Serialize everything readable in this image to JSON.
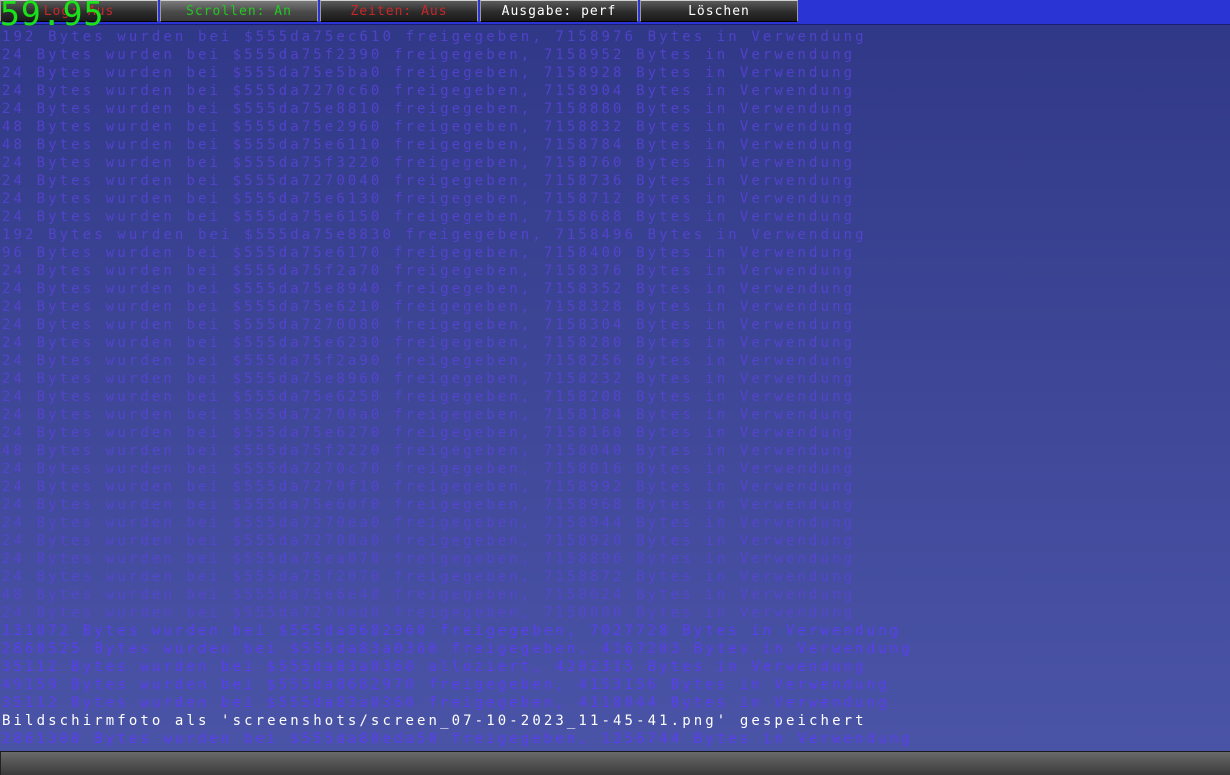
{
  "fps": "59.95",
  "toolbar": {
    "buttons": [
      {
        "label": "Log: Aus"
      },
      {
        "label": "Scrollen: An"
      },
      {
        "label": "Zeiten: Aus"
      },
      {
        "label": "Ausgabe: perf"
      },
      {
        "label": "Löschen"
      }
    ]
  },
  "console": {
    "lines": [
      "192 Bytes wurden bei $555da75ec610 freigegeben, 7158976 Bytes in Verwendung",
      "24 Bytes wurden bei $555da75f2390 freigegeben, 7158952 Bytes in Verwendung",
      "24 Bytes wurden bei $555da75e5ba0 freigegeben, 7158928 Bytes in Verwendung",
      "24 Bytes wurden bei $555da7270c60 freigegeben, 7158904 Bytes in Verwendung",
      "24 Bytes wurden bei $555da75e8810 freigegeben, 7158880 Bytes in Verwendung",
      "48 Bytes wurden bei $555da75e2960 freigegeben, 7158832 Bytes in Verwendung",
      "48 Bytes wurden bei $555da75e6110 freigegeben, 7158784 Bytes in Verwendung",
      "24 Bytes wurden bei $555da75f3220 freigegeben, 7158760 Bytes in Verwendung",
      "24 Bytes wurden bei $555da7270040 freigegeben, 7158736 Bytes in Verwendung",
      "24 Bytes wurden bei $555da75e6130 freigegeben, 7158712 Bytes in Verwendung",
      "24 Bytes wurden bei $555da75e6150 freigegeben, 7158688 Bytes in Verwendung",
      "192 Bytes wurden bei $555da75e8830 freigegeben, 7158496 Bytes in Verwendung",
      "96 Bytes wurden bei $555da75e6170 freigegeben, 7158400 Bytes in Verwendung",
      "24 Bytes wurden bei $555da75f2a70 freigegeben, 7158376 Bytes in Verwendung",
      "24 Bytes wurden bei $555da75e8940 freigegeben, 7158352 Bytes in Verwendung",
      "24 Bytes wurden bei $555da75e6210 freigegeben, 7158328 Bytes in Verwendung",
      "24 Bytes wurden bei $555da7270080 freigegeben, 7158304 Bytes in Verwendung",
      "24 Bytes wurden bei $555da75e6230 freigegeben, 7158280 Bytes in Verwendung",
      "24 Bytes wurden bei $555da75f2a90 freigegeben, 7158256 Bytes in Verwendung",
      "24 Bytes wurden bei $555da75e8960 freigegeben, 7158232 Bytes in Verwendung",
      "24 Bytes wurden bei $555da75e6250 freigegeben, 7158208 Bytes in Verwendung",
      "24 Bytes wurden bei $555da72700a0 freigegeben, 7158184 Bytes in Verwendung",
      "24 Bytes wurden bei $555da75e6270 freigegeben, 7158160 Bytes in Verwendung",
      "48 Bytes wurden bei $555da75f2220 freigegeben, 7158040 Bytes in Verwendung",
      "24 Bytes wurden bei $555da7270c70 freigegeben, 7158016 Bytes in Verwendung",
      "24 Bytes wurden bei $555da7270f10 freigegeben, 7158992 Bytes in Verwendung",
      "24 Bytes wurden bei $555da75e60f0 freigegeben, 7158968 Bytes in Verwendung",
      "24 Bytes wurden bei $555da7270ea0 freigegeben, 7158944 Bytes in Verwendung",
      "24 Bytes wurden bei $555da72708a0 freigegeben, 7158920 Bytes in Verwendung",
      "24 Bytes wurden bei $555da75ea070 freigegeben, 7158896 Bytes in Verwendung",
      "24 Bytes wurden bei $555da75f2070 freigegeben, 7158872 Bytes in Verwendung",
      "48 Bytes wurden bei $555da75e6e40 freigegeben, 7158024 Bytes in Verwendung",
      "24 Bytes wurden bei $555da7270ed0 freigegeben, 7158000 Bytes in Verwendung",
      "131072 Bytes wurden bei $555da8682960 freigegeben, 7027728 Bytes in Verwendung",
      "2860525 Bytes wurden bei $555da83a0360 freigegeben, 4167203 Bytes in Verwendung",
      "35112 Bytes wurden bei $555da83a0360 alloziert, 4202315 Bytes in Verwendung",
      "49159 Bytes wurden bei $555da8682970 freigegeben, 4153156 Bytes in Verwendung",
      "35112 Bytes wurden bei $555da83a0360 freigegeben, 4118044 Bytes in Verwendung",
      "Bildschirmfoto als 'screenshots/screen_07-10-2023_11-45-41.png' gespeichert",
      "2861300 Bytes wurden bei $555da80eda50 freigegeben, 1256744 Bytes in Verwendung"
    ]
  },
  "input": {
    "value": ""
  },
  "colors": {
    "toolbar_bg": "#2a34d4",
    "fps": "#1de01d",
    "log_text": "#5a3ef0",
    "highlight_text": "#ffffff",
    "off_state": "#c8282a",
    "on_state": "#22c822"
  }
}
